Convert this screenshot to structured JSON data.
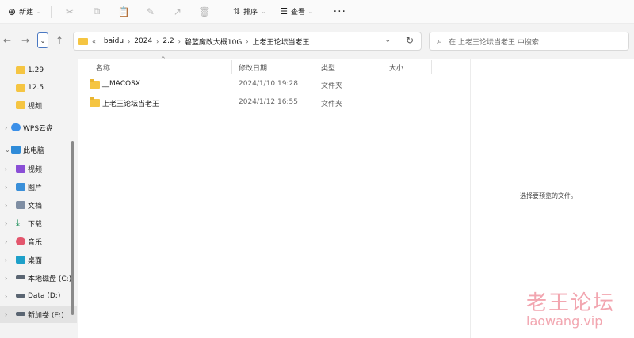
{
  "toolbar": {
    "new_label": "新建",
    "sort_label": "排序",
    "view_label": "查看",
    "more": "···"
  },
  "nav": {
    "address_crumbs": [
      "baidu",
      "2024",
      "2.2",
      "碧蓝魔改大概10G",
      "上老王论坛当老王"
    ],
    "overflow": "«",
    "search_placeholder": "在 上老王论坛当老王 中搜索"
  },
  "sidebar": {
    "items": [
      {
        "label": "1.29",
        "icon": "folder-icon"
      },
      {
        "label": "12.5",
        "icon": "folder-icon"
      },
      {
        "label": "视频",
        "icon": "folder-icon"
      },
      {
        "label": "WPS云盘",
        "icon": "cloud-icon"
      },
      {
        "label": "此电脑",
        "icon": "computer-icon"
      },
      {
        "label": "视频",
        "icon": "video-icon"
      },
      {
        "label": "图片",
        "icon": "pictures-icon"
      },
      {
        "label": "文档",
        "icon": "documents-icon"
      },
      {
        "label": "下载",
        "icon": "download-icon"
      },
      {
        "label": "音乐",
        "icon": "music-icon"
      },
      {
        "label": "桌面",
        "icon": "desktop-icon"
      },
      {
        "label": "本地磁盘 (C:)",
        "icon": "drive-icon"
      },
      {
        "label": "Data (D:)",
        "icon": "drive-icon"
      },
      {
        "label": "新加卷 (E:)",
        "icon": "drive-icon"
      }
    ]
  },
  "table": {
    "headers": {
      "name": "名称",
      "date": "修改日期",
      "type": "类型",
      "size": "大小"
    },
    "rows": [
      {
        "name": "__MACOSX",
        "date": "2024/1/10 19:28",
        "type": "文件夹",
        "size": ""
      },
      {
        "name": "上老王论坛当老王",
        "date": "2024/1/12 16:55",
        "type": "文件夹",
        "size": ""
      }
    ]
  },
  "preview": {
    "empty_text": "选择要预览的文件。"
  },
  "watermark": {
    "cn": "老王论坛",
    "en": "laowang.vip"
  },
  "colors": {
    "folder": "#f5c542",
    "accent": "#4a78c2",
    "watermark": "#f2a6b0"
  }
}
